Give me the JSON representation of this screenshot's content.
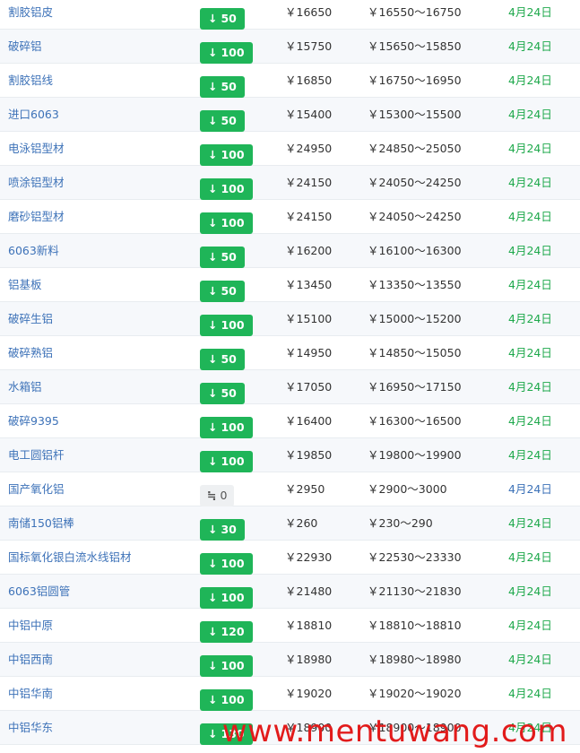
{
  "rows": [
    {
      "name": "割胶铝皮",
      "direction": "down",
      "change": "50",
      "avg": "￥16650",
      "range": "￥16550～16750",
      "date": "4月24日",
      "date_color": "green"
    },
    {
      "name": "破碎铝",
      "direction": "down",
      "change": "100",
      "avg": "￥15750",
      "range": "￥15650～15850",
      "date": "4月24日",
      "date_color": "green"
    },
    {
      "name": "割胶铝线",
      "direction": "down",
      "change": "50",
      "avg": "￥16850",
      "range": "￥16750～16950",
      "date": "4月24日",
      "date_color": "green"
    },
    {
      "name": "进口6063",
      "direction": "down",
      "change": "50",
      "avg": "￥15400",
      "range": "￥15300～15500",
      "date": "4月24日",
      "date_color": "green"
    },
    {
      "name": "电泳铝型材",
      "direction": "down",
      "change": "100",
      "avg": "￥24950",
      "range": "￥24850～25050",
      "date": "4月24日",
      "date_color": "green"
    },
    {
      "name": "喷涂铝型材",
      "direction": "down",
      "change": "100",
      "avg": "￥24150",
      "range": "￥24050～24250",
      "date": "4月24日",
      "date_color": "green"
    },
    {
      "name": "磨砂铝型材",
      "direction": "down",
      "change": "100",
      "avg": "￥24150",
      "range": "￥24050～24250",
      "date": "4月24日",
      "date_color": "green"
    },
    {
      "name": "6063新料",
      "direction": "down",
      "change": "50",
      "avg": "￥16200",
      "range": "￥16100～16300",
      "date": "4月24日",
      "date_color": "green"
    },
    {
      "name": "铝基板",
      "direction": "down",
      "change": "50",
      "avg": "￥13450",
      "range": "￥13350～13550",
      "date": "4月24日",
      "date_color": "green"
    },
    {
      "name": "破碎生铝",
      "direction": "down",
      "change": "100",
      "avg": "￥15100",
      "range": "￥15000～15200",
      "date": "4月24日",
      "date_color": "green"
    },
    {
      "name": "破碎熟铝",
      "direction": "down",
      "change": "50",
      "avg": "￥14950",
      "range": "￥14850～15050",
      "date": "4月24日",
      "date_color": "green"
    },
    {
      "name": "水箱铝",
      "direction": "down",
      "change": "50",
      "avg": "￥17050",
      "range": "￥16950～17150",
      "date": "4月24日",
      "date_color": "green"
    },
    {
      "name": "破碎9395",
      "direction": "down",
      "change": "100",
      "avg": "￥16400",
      "range": "￥16300～16500",
      "date": "4月24日",
      "date_color": "green"
    },
    {
      "name": "电工圆铝杆",
      "direction": "down",
      "change": "100",
      "avg": "￥19850",
      "range": "￥19800～19900",
      "date": "4月24日",
      "date_color": "green"
    },
    {
      "name": "国产氧化铝",
      "direction": "flat",
      "change": "0",
      "avg": "￥2950",
      "range": "￥2900～3000",
      "date": "4月24日",
      "date_color": "blue"
    },
    {
      "name": "南储150铝棒",
      "direction": "down",
      "change": "30",
      "avg": "￥260",
      "range": "￥230～290",
      "date": "4月24日",
      "date_color": "green"
    },
    {
      "name": "国标氧化银白流水线铝材",
      "direction": "down",
      "change": "100",
      "avg": "￥22930",
      "range": "￥22530～23330",
      "date": "4月24日",
      "date_color": "green"
    },
    {
      "name": "6063铝圆管",
      "direction": "down",
      "change": "100",
      "avg": "￥21480",
      "range": "￥21130～21830",
      "date": "4月24日",
      "date_color": "green"
    },
    {
      "name": "中铝中原",
      "direction": "down",
      "change": "120",
      "avg": "￥18810",
      "range": "￥18810～18810",
      "date": "4月24日",
      "date_color": "green"
    },
    {
      "name": "中铝西南",
      "direction": "down",
      "change": "100",
      "avg": "￥18980",
      "range": "￥18980～18980",
      "date": "4月24日",
      "date_color": "green"
    },
    {
      "name": "中铝华南",
      "direction": "down",
      "change": "100",
      "avg": "￥19020",
      "range": "￥19020～19020",
      "date": "4月24日",
      "date_color": "green"
    },
    {
      "name": "中铝华东",
      "direction": "down",
      "change": "130",
      "avg": "￥18900",
      "range": "￥18900～18900",
      "date": "4月24日",
      "date_color": "green"
    }
  ],
  "icons": {
    "down": "down-arrow-icon",
    "flat": "flat-approx-icon"
  },
  "colors": {
    "badge_down": "#1fb558",
    "badge_flat": "#eef0f2",
    "link": "#3d72b8",
    "date_green": "#1fa94c"
  },
  "watermark": "www.mentuwang.com"
}
